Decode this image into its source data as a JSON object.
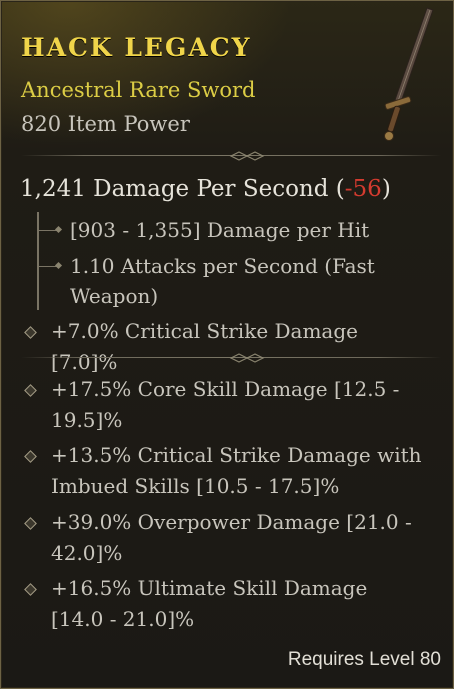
{
  "item": {
    "name": "HACK LEGACY",
    "type": "Ancestral Rare Sword",
    "power": "820 Item Power",
    "icon": "sword-icon"
  },
  "dps": {
    "value": "1,241 Damage Per Second",
    "open_paren": " (",
    "delta": "-56",
    "close_paren": ")",
    "delta_color": "#d33b2f"
  },
  "stats": [
    "[903 - 1,355] Damage per Hit",
    "1.10 Attacks per Second (Fast Weapon)"
  ],
  "implicit": [
    "+7.0% Critical Strike Damage [7.0]%"
  ],
  "affixes": [
    "+17.5% Core Skill Damage [12.5 - 19.5]%",
    "+13.5% Critical Strike Damage with Imbued Skills [10.5 - 17.5]%",
    "+39.0% Overpower Damage [21.0 - 42.0]%",
    "+16.5% Ultimate Skill Damage [14.0 - 21.0]%"
  ],
  "requirement": "Requires Level 80",
  "colors": {
    "title": "#f0d54a",
    "rare": "#dccd45",
    "text": "#c8c5bc"
  }
}
